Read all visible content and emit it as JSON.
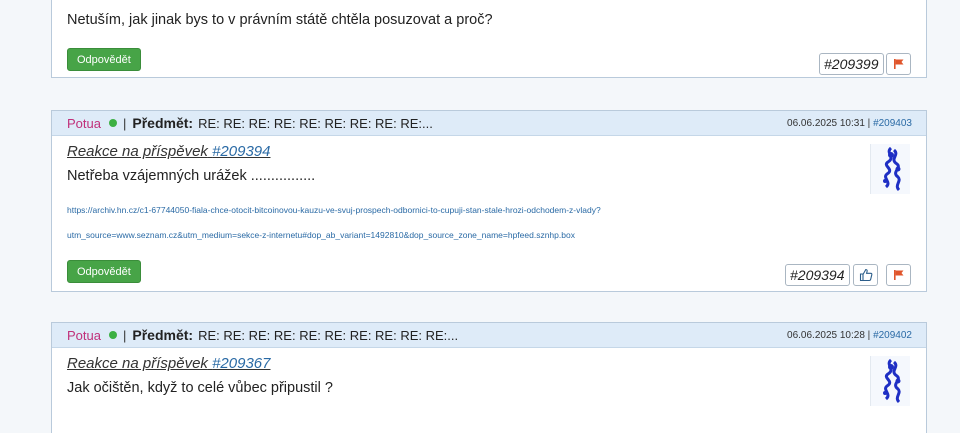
{
  "post_top": {
    "text": "Netuším, jak jinak bys to v právním státě chtěla posuzovat a proč?",
    "reply_label": "Odpovědět",
    "post_id": "#209399"
  },
  "post1": {
    "author": "Potua",
    "subject_label": "Předmět:",
    "subject": "RE: RE: RE: RE: RE: RE: RE: RE: RE:...",
    "separator": "|",
    "date": "06.06.2025 10:31",
    "meta_sep": "|",
    "meta_link": "#209403",
    "reply_to_prefix": "Reakce na příspěvek",
    "reply_to_link": "#209394",
    "text": "Netřeba vzájemných urážek ................",
    "link_line1": "https://archiv.hn.cz/c1-67744050-fiala-chce-otocit-bitcoinovou-kauzu-ve-svuj-prospech-odbornici-to-cupuji-stan-stale-hrozi-odchodem-z-vlady?",
    "link_line2": "utm_source=www.seznam.cz&utm_medium=sekce-z-internetu#dop_ab_variant=1492810&dop_source_zone_name=hpfeed.sznhp.box",
    "reply_label": "Odpovědět",
    "post_id": "#209394"
  },
  "post2": {
    "author": "Potua",
    "subject_label": "Předmět:",
    "subject": "RE: RE: RE: RE: RE: RE: RE: RE: RE: RE:...",
    "separator": "|",
    "date": "06.06.2025 10:28",
    "meta_sep": "|",
    "meta_link": "#209402",
    "reply_to_prefix": "Reakce na příspěvek",
    "reply_to_link": "#209367",
    "text": "Jak očištěn, když to celé vůbec připustil ?"
  },
  "icons": {
    "flag": "flag-icon",
    "like": "thumbs-up-icon",
    "avatar": "avatar"
  },
  "colors": {
    "accent_green": "#47a447",
    "header_bg": "#deebf8",
    "author": "#c0307a",
    "link": "#2a6aa5",
    "flag": "#e0552b"
  }
}
